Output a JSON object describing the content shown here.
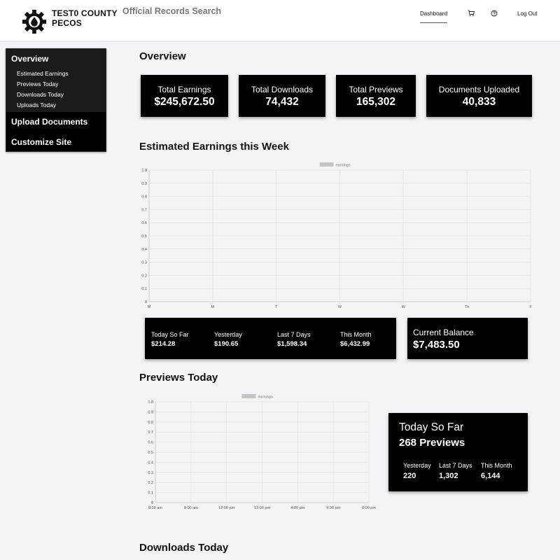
{
  "header": {
    "logo_line1": "TEST0 COUNTY",
    "logo_line2": "PECOS",
    "subtitle": "Official Records Search",
    "nav_dashboard": "Dashboard",
    "nav_logout": "Log Out"
  },
  "sidebar": {
    "overview": "Overview",
    "sub_items": [
      "Estimated Earnings",
      "Previews Today",
      "Downloads Today",
      "Uploads Today"
    ],
    "upload_documents": "Upload Documents",
    "customize_site": "Customize Site"
  },
  "overview": {
    "title": "Overview",
    "cards": [
      {
        "label": "Total Earnings",
        "value": "$245,672.50"
      },
      {
        "label": "Total Downloads",
        "value": "74,432"
      },
      {
        "label": "Total Previews",
        "value": "165,302"
      },
      {
        "label": "Documents Uploaded",
        "value": "40,833"
      }
    ]
  },
  "earnings": {
    "title": "Estimated Earnings this Week",
    "summary": [
      {
        "label": "Today So Far",
        "value": "$214.28"
      },
      {
        "label": "Yesterday",
        "value": "$190.65"
      },
      {
        "label": "Last 7 Days",
        "value": "$1,598.34"
      },
      {
        "label": "This Month",
        "value": "$6,432.99"
      }
    ],
    "balance_label": "Current Balance",
    "balance_value": "$7,483.50"
  },
  "previews": {
    "title": "Previews Today",
    "today_label": "Today So Far",
    "today_value": "268 Previews",
    "summary": [
      {
        "label": "Yesterday",
        "value": "220"
      },
      {
        "label": "Last 7 Days",
        "value": "1,302"
      },
      {
        "label": "This Month",
        "value": "6,144"
      }
    ]
  },
  "downloads": {
    "title": "Downloads Today"
  },
  "chart_data": [
    {
      "type": "line",
      "title": "Estimated Earnings this Week",
      "categories": [
        "M",
        "M",
        "T",
        "W",
        "W",
        "Th",
        "F"
      ],
      "series": [
        {
          "name": "earnings",
          "values": []
        }
      ],
      "ylim": [
        0,
        1.0
      ],
      "yticks": [
        "0",
        "0.1",
        "0.2",
        "0.3",
        "0.4",
        "0.5",
        "0.6",
        "0.7",
        "0.8",
        "0.9",
        "1.0"
      ],
      "grid": true,
      "legend": "top-center"
    },
    {
      "type": "line",
      "title": "Previews Today",
      "categories": [
        "8:00 am",
        "8:00 am",
        "12:00 pm",
        "12:00 pm",
        "4:00 pm",
        "4:00 pm",
        "8:00 pm"
      ],
      "series": [
        {
          "name": "earnings",
          "values": []
        }
      ],
      "ylim": [
        0,
        1.0
      ],
      "yticks": [
        "0",
        "0.1",
        "0.2",
        "0.3",
        "0.4",
        "0.5",
        "0.6",
        "0.7",
        "0.8",
        "0.9",
        "1.0"
      ],
      "grid": true,
      "legend": "top-center"
    }
  ]
}
